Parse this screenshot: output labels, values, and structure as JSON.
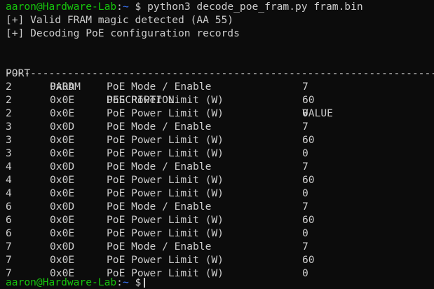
{
  "prompt": {
    "user_host": "aaron@Hardware-Lab",
    "sep": ":",
    "path": "~",
    "dollar": "$",
    "command": "python3 decode_poe_fram.py fram.bin"
  },
  "output": {
    "line1": "[+] Valid FRAM magic detected (AA 55)",
    "line2": "[+] Decoding PoE configuration records"
  },
  "table": {
    "headers": {
      "port": "PORT",
      "param": "PARAM",
      "description": "DESCRIPTION",
      "value": "VALUE"
    },
    "separator": "----------------------------------------------------------------------",
    "rows": [
      {
        "port": "2",
        "param": "0x0D",
        "description": "PoE Mode / Enable",
        "value": "7"
      },
      {
        "port": "2",
        "param": "0x0E",
        "description": "PoE Power Limit (W)",
        "value": "60"
      },
      {
        "port": "2",
        "param": "0x0E",
        "description": "PoE Power Limit (W)",
        "value": "0"
      },
      {
        "port": "3",
        "param": "0x0D",
        "description": "PoE Mode / Enable",
        "value": "7"
      },
      {
        "port": "3",
        "param": "0x0E",
        "description": "PoE Power Limit (W)",
        "value": "60"
      },
      {
        "port": "3",
        "param": "0x0E",
        "description": "PoE Power Limit (W)",
        "value": "0"
      },
      {
        "port": "4",
        "param": "0x0D",
        "description": "PoE Mode / Enable",
        "value": "7"
      },
      {
        "port": "4",
        "param": "0x0E",
        "description": "PoE Power Limit (W)",
        "value": "60"
      },
      {
        "port": "4",
        "param": "0x0E",
        "description": "PoE Power Limit (W)",
        "value": "0"
      },
      {
        "port": "6",
        "param": "0x0D",
        "description": "PoE Mode / Enable",
        "value": "7"
      },
      {
        "port": "6",
        "param": "0x0E",
        "description": "PoE Power Limit (W)",
        "value": "60"
      },
      {
        "port": "6",
        "param": "0x0E",
        "description": "PoE Power Limit (W)",
        "value": "0"
      },
      {
        "port": "7",
        "param": "0x0D",
        "description": "PoE Mode / Enable",
        "value": "7"
      },
      {
        "port": "7",
        "param": "0x0E",
        "description": "PoE Power Limit (W)",
        "value": "60"
      },
      {
        "port": "7",
        "param": "0x0E",
        "description": "PoE Power Limit (W)",
        "value": "0"
      }
    ]
  },
  "final_prompt": {
    "user_host": "aaron@Hardware-Lab",
    "sep": ":",
    "path": "~",
    "dollar": "$"
  },
  "colors": {
    "background": "#0c0c0c",
    "text": "#cccccc",
    "user_host": "#16c60c",
    "path": "#3b78ff"
  }
}
